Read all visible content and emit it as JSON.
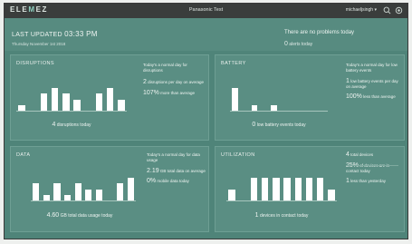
{
  "app": {
    "logo_left": "ELE",
    "logo_accent": "M",
    "logo_right": "EZ",
    "title": "Panasonic Test",
    "user": "michaeljsingh ▾"
  },
  "icons": {
    "search": "search-icon",
    "settings": "gear-icon"
  },
  "header": {
    "updated_label": "LAST UPDATED",
    "updated_time": "03:33 PM",
    "date": "Thursday November 1st 2018",
    "status": "There are no problems today",
    "alerts_num": "0",
    "alerts_text": "alerts today"
  },
  "disruptions": {
    "title": "DISRUPTIONS",
    "foot_num": "4",
    "foot_text": "disruptions today",
    "side_line1": "Today's a normal day for disruptions",
    "side_num2": "2",
    "side_text2": "disruptions per day on average",
    "side_num3": "107%",
    "side_text3": "more than average"
  },
  "battery": {
    "title": "BATTERY",
    "foot_num": "0",
    "foot_text": "low battery events today",
    "side_line1": "Today's a normal day for low battery events",
    "side_num2": "1",
    "side_text2": "low battery events per day on average",
    "side_num3": "100%",
    "side_text3": "less than average"
  },
  "data": {
    "title": "DATA",
    "foot_num": "4.60",
    "foot_text": "GB total data usage today",
    "side_line1": "Today's a normal day for data usage",
    "side_num2": "2.19",
    "side_text2": "GB total data on average",
    "side_num3": "0%",
    "side_text3": "mobile data today"
  },
  "utilization": {
    "title": "UTILIZATION",
    "foot_num": "1",
    "foot_text": "devices in contact today",
    "side_num1": "4",
    "side_text1": "total devices",
    "side_num2": "25%",
    "side_text2": "of devices are in contact today",
    "side_num3": "1",
    "side_text3": "less than yesterday"
  },
  "chart_data": [
    {
      "type": "bar",
      "title": "DISRUPTIONS",
      "values": [
        1,
        0,
        3,
        4,
        3,
        2,
        0,
        3,
        4,
        2
      ]
    },
    {
      "type": "bar",
      "title": "BATTERY",
      "values": [
        4,
        0,
        1,
        0,
        1,
        0,
        0,
        0,
        0,
        0
      ]
    },
    {
      "type": "bar",
      "title": "DATA",
      "values": [
        3,
        1,
        3,
        1,
        3,
        2,
        2,
        0,
        3,
        4
      ]
    },
    {
      "type": "bar",
      "title": "UTILIZATION",
      "values": [
        2,
        0,
        4,
        4,
        4,
        4,
        4,
        4,
        4,
        2
      ]
    }
  ]
}
